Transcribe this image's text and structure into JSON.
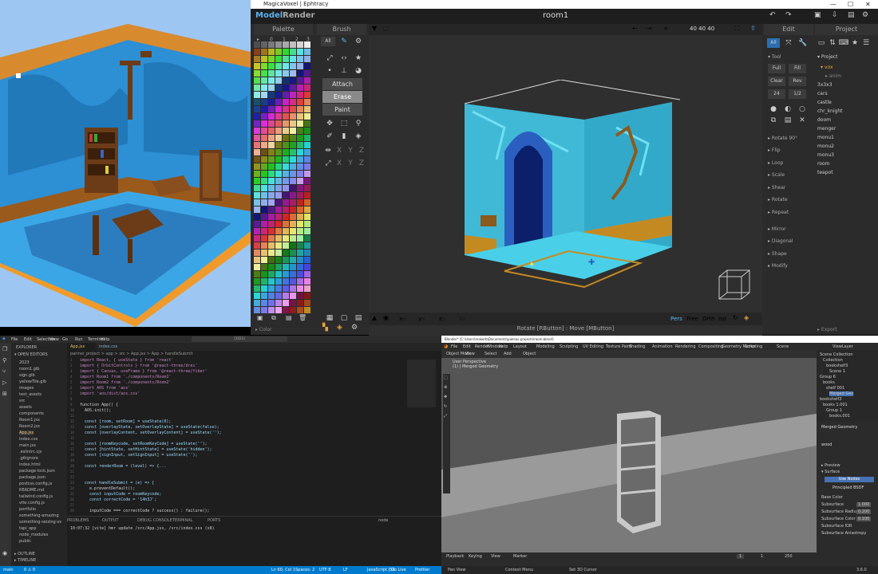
{
  "magicavoxel": {
    "window_title": "MagicaVoxel | Ephtracy",
    "menu": {
      "model": "Model",
      "render": "Render"
    },
    "scene_title": "room1",
    "dims": "40 40 40",
    "palette": {
      "title": "Palette",
      "tabs": [
        "0",
        "1",
        "2",
        "3"
      ],
      "footer": "Color"
    },
    "brush": {
      "title": "Brush",
      "all": "All",
      "attach": "Attach",
      "erase": "Erase",
      "paint": "Paint",
      "axes": [
        "X",
        "Y",
        "Z"
      ]
    },
    "viewport": {
      "coords": [
        "x:-",
        "y:-",
        "z:-",
        "i:-"
      ],
      "modes": [
        "Pers",
        "Free",
        "Orth",
        "Iso"
      ],
      "status": "Rotate [RButton] : Move [MButton]"
    },
    "edit": {
      "title": "Edit",
      "all": "All",
      "tool": "Tool",
      "buttons": [
        "Full",
        "Fill",
        "Clear",
        "Rev",
        "24",
        "1/2"
      ],
      "sections": [
        "Rotate 90°",
        "Flip",
        "Loop",
        "Scale",
        "Shear",
        "Rotate",
        "Repeat",
        "Mirror",
        "Diagonal",
        "Shape",
        "Modify"
      ]
    },
    "project": {
      "title": "Project",
      "root": "Project",
      "vox": "vox",
      "items": [
        "anim",
        "3x3x3",
        "cars",
        "castle",
        "chr_knight",
        "doom",
        "menger",
        "monu1",
        "monu2",
        "monu3",
        "room",
        "teapot"
      ],
      "export": "Export"
    }
  },
  "vscode": {
    "menu": [
      "File",
      "Edit",
      "Selection",
      "View",
      "Go",
      "Run",
      "Terminal",
      "Help"
    ],
    "search": "[2023]",
    "tabs": [
      "App.jsx",
      "index.css"
    ],
    "breadcrumb": "parinei_project > app > src > App.jsx > App > handleSubmit",
    "explorer": "EXPLORER",
    "open_editors": "OPEN EDITORS",
    "files": [
      "2023",
      "room1.glb",
      "sign.glb",
      "yellowTile.glb",
      "images",
      "test_assets",
      "src",
      "assets",
      "components",
      "Room1.jsx",
      "Room2.jsx",
      "App.jsx",
      "index.css",
      "main.jsx",
      ".eslintrc.cjs",
      ".gitignore",
      "index.html",
      "package-lock.json",
      "package.json",
      "postcss.config.js",
      "README.md",
      "tailwind.config.js",
      "vite.config.js",
      "portfolio",
      "something-amazing",
      "something-seizing-vs",
      "tapi_app",
      "node_modules",
      "public"
    ],
    "outline": "OUTLINE",
    "timeline": "TIMELINE",
    "code": [
      "import React, { useState } from 'react'",
      "import { OrbitControls } from '@react-three/drei'",
      "import { Canvas, useFrame } from '@react-three/fiber'",
      "import Room1 from './components/Room1'",
      "import Room2 from './components/Room2'",
      "import AOS from 'aos'",
      "import 'aos/dist/aos.css'",
      "",
      "function App() {",
      "  AOS.init();",
      "",
      "  const [room, setRoom] = useState(0);",
      "  const [overlayState, setOverlayState] = useState(false);",
      "  const [overlayContent, setOverlayContent] = useState('');",
      "",
      "  const [roomKeycode, setRoomKeyCode] = useState('');",
      "  const [hintState, setHintState] = useState('hidden');",
      "  const [signInput, setSignInput] = useState('');",
      "",
      "  const renderRoom = (level) => {...",
      "",
      "",
      "  const handleSubmit = (e) => {",
      "    e.preventDefault();",
      "    const inputCode = roomKeycode;",
      "    const correctCode = '14h3J';",
      "",
      "    inputCode === correctCode ? success() : failure();"
    ],
    "panel_tabs": [
      "PROBLEMS",
      "OUTPUT",
      "DEBUG CONSOLE",
      "TERMINAL",
      "PORTS"
    ],
    "terminal_line": "10:07:32 [vite] hmr update /src/App.jsx, /src/index.css (x8)",
    "terminal_label": "node",
    "status_left": [
      "main",
      "0 ⚠ 0"
    ],
    "status_right": [
      "Ln 60, Col 1",
      "Spaces: 2",
      "UTF-8",
      "LF",
      "JavaScript JSX",
      "Go Live",
      "Prettier"
    ]
  },
  "blender": {
    "title": "Blender* [C:\\Users\\makerb\\Documents\\palmas projects\\room.blend]",
    "menu": [
      "File",
      "Edit",
      "Render",
      "Window",
      "Help"
    ],
    "workspaces": [
      "Layout",
      "Modeling",
      "Sculpting",
      "UV Editing",
      "Texture Paint",
      "Shading",
      "Animation",
      "Rendering",
      "Compositing",
      "Geometry Nodes",
      "Scripting"
    ],
    "scene": "Scene",
    "view_layer": "ViewLayer",
    "viewport_header": [
      "Object Mode",
      "View",
      "Select",
      "Add",
      "Object"
    ],
    "view_info": [
      "User Perspective",
      "(1) | Merged Geometry"
    ],
    "outliner": [
      "Scene Collection",
      "Collection",
      "bookshelf3",
      "Scene 1",
      "Group 6",
      "books",
      "shelf 001",
      "Merged Geo",
      "bookshelf3",
      "books 1.001",
      "Group 1",
      "books.001"
    ],
    "properties": {
      "object": "Merged Geometry",
      "material": "wood",
      "surface": "Surface",
      "preview": "Preview",
      "use_nodes": "Use Nodes",
      "surface_type": "Principled BSDF",
      "fields": [
        "Base Color",
        "Subsurface",
        "Subsurface Radius",
        "Subsurface Color",
        "Subsurface IOR",
        "Subsurface Anisotropy"
      ],
      "values": [
        "1.000",
        "0.200",
        "0.100"
      ]
    },
    "timeline": {
      "items": [
        "Playback",
        "Keying",
        "View",
        "Marker"
      ],
      "frame": "1",
      "start": "1",
      "end": "250"
    },
    "status": [
      "Pan View",
      "Context Menu",
      "Set 3D Cursor",
      "3.6.0"
    ]
  }
}
